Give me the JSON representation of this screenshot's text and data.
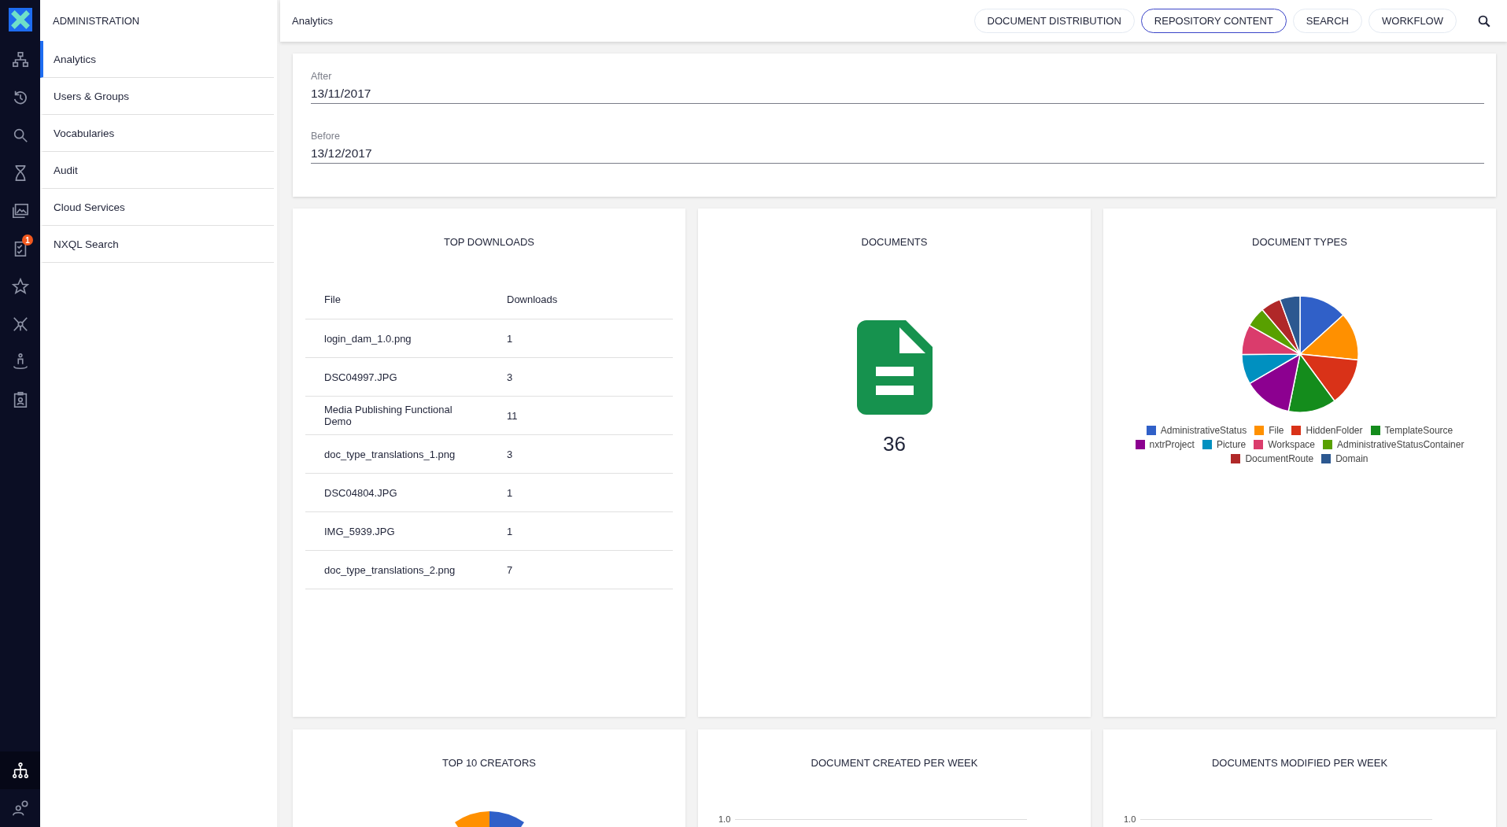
{
  "sidebar": {
    "title": "ADMINISTRATION",
    "items": [
      {
        "label": "Analytics",
        "selected": true
      },
      {
        "label": "Users & Groups",
        "selected": false
      },
      {
        "label": "Vocabularies",
        "selected": false
      },
      {
        "label": "Audit",
        "selected": false
      },
      {
        "label": "Cloud Services",
        "selected": false
      },
      {
        "label": "NXQL Search",
        "selected": false
      }
    ]
  },
  "rail": {
    "top": [
      {
        "kind": "tree",
        "selected": false
      },
      {
        "kind": "history",
        "selected": false
      },
      {
        "kind": "search",
        "selected": false
      },
      {
        "kind": "hourglass",
        "selected": false
      },
      {
        "kind": "gallery",
        "selected": false
      },
      {
        "kind": "tasks",
        "selected": false,
        "badge": "1"
      },
      {
        "kind": "star",
        "selected": false
      },
      {
        "kind": "network",
        "selected": false
      },
      {
        "kind": "upload",
        "selected": false
      },
      {
        "kind": "badge",
        "selected": false
      }
    ],
    "bottom": [
      {
        "kind": "org",
        "selected": true
      },
      {
        "kind": "usergear",
        "selected": false
      }
    ]
  },
  "header": {
    "title": "Analytics",
    "tabs": [
      {
        "label": "DOCUMENT DISTRIBUTION",
        "selected": false
      },
      {
        "label": "REPOSITORY CONTENT",
        "selected": true
      },
      {
        "label": "SEARCH",
        "selected": false
      },
      {
        "label": "WORKFLOW",
        "selected": false
      }
    ]
  },
  "date_fields": [
    {
      "label": "After",
      "value": "13/11/2017"
    },
    {
      "label": "Before",
      "value": "13/12/2017"
    }
  ],
  "top_downloads": {
    "title": "TOP DOWNLOADS",
    "columns": [
      "File",
      "Downloads"
    ],
    "rows": [
      [
        "login_dam_1.0.png",
        "1"
      ],
      [
        "DSC04997.JPG",
        "3"
      ],
      [
        "Media Publishing Functional Demo",
        "11"
      ],
      [
        "doc_type_translations_1.png",
        "3"
      ],
      [
        "DSC04804.JPG",
        "1"
      ],
      [
        "IMG_5939.JPG",
        "1"
      ],
      [
        "doc_type_translations_2.png",
        "7"
      ]
    ]
  },
  "documents": {
    "title": "DOCUMENTS",
    "count": "36"
  },
  "document_types": {
    "title": "DOCUMENT TYPES",
    "legend": [
      {
        "label": "AdministrativeStatus",
        "color": "#3060c8"
      },
      {
        "label": "File",
        "color": "#ff9000"
      },
      {
        "label": "HiddenFolder",
        "color": "#d93218"
      },
      {
        "label": "TemplateSource",
        "color": "#148c1c"
      },
      {
        "label": "nxtrProject",
        "color": "#8c0090"
      },
      {
        "label": "Picture",
        "color": "#0090c0"
      },
      {
        "label": "Workspace",
        "color": "#da3c6c"
      },
      {
        "label": "AdministrativeStatusContainer",
        "color": "#58a000"
      },
      {
        "label": "DocumentRoute",
        "color": "#b02828"
      },
      {
        "label": "Domain",
        "color": "#2c5890"
      }
    ]
  },
  "lower_cards": [
    {
      "title": "TOP 10 CREATORS",
      "kind": "pie"
    },
    {
      "title": "DOCUMENT CREATED PER WEEK",
      "kind": "line",
      "y_tick": "1.0"
    },
    {
      "title": "DOCUMENTS MODIFIED PER WEEK",
      "kind": "line",
      "y_tick": "1.0"
    }
  ]
}
